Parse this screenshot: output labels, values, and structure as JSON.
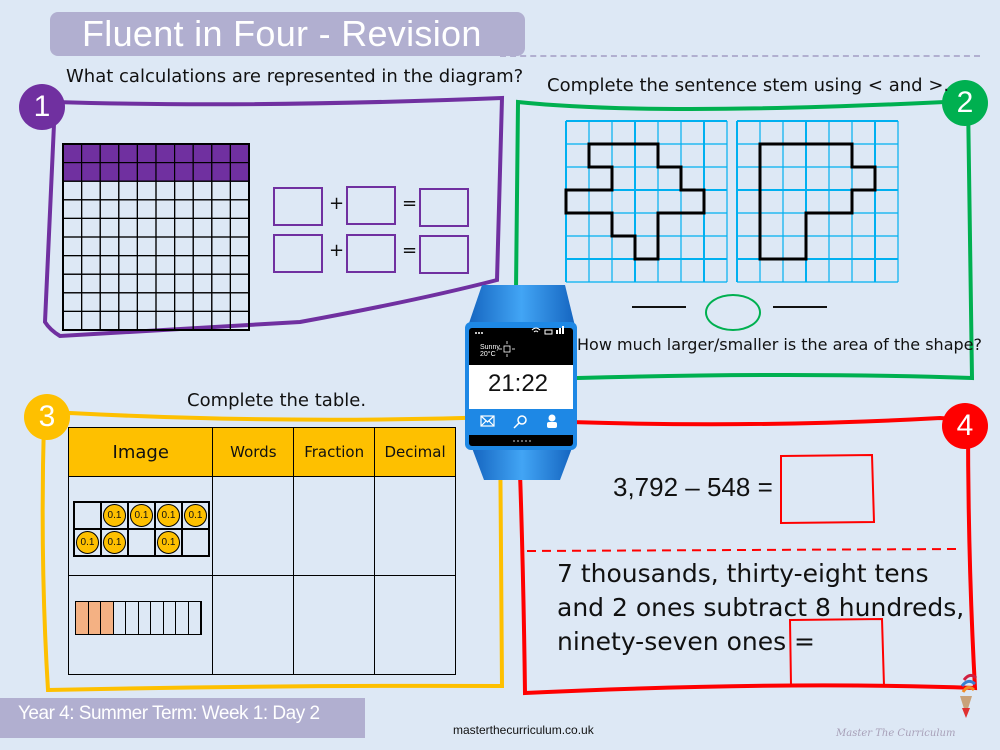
{
  "header": {
    "title": "Fluent in Four - Revision"
  },
  "question1": {
    "number": "1",
    "prompt": "What calculations are represented in the diagram?",
    "hundred_square": {
      "rows": 10,
      "cols": 10,
      "shaded_rows": 2,
      "shaded_count": 20,
      "shade_color": "#7030a0"
    },
    "equations": [
      {
        "plus": "+",
        "equals": "="
      },
      {
        "plus": "+",
        "equals": "="
      }
    ],
    "color": "#7030a0"
  },
  "question2": {
    "number": "2",
    "prompt": "Complete the sentence stem using < and >.",
    "sub_prompt": "How much larger/smaller is the area of the shape?",
    "grid": {
      "rows": 7,
      "cols": 7,
      "line_color": "#00b0f0"
    },
    "shape_a_area": 15,
    "shape_b_area": 15,
    "color": "#00b050"
  },
  "question3": {
    "number": "3",
    "prompt": "Complete the table.",
    "columns": [
      "Image",
      "Words",
      "Fraction",
      "Decimal"
    ],
    "row1_counters": {
      "label": "0.1",
      "layout": [
        [
          0,
          1,
          1,
          1,
          1
        ],
        [
          1,
          1,
          0,
          1,
          0
        ]
      ],
      "count": 7
    },
    "row2_strips": {
      "total": 10,
      "shaded": 3,
      "shade_color": "#f4b183"
    },
    "color": "#fec000"
  },
  "question4": {
    "number": "4",
    "equation": "3,792 – 548 =",
    "word_problem": [
      "7 thousands, thirty-eight tens",
      "and 2 ones subtract 8 hundreds,",
      "ninety-seven ones ="
    ],
    "color": "#ff0000"
  },
  "watch": {
    "time": "21:22",
    "weather": "Sunny",
    "temperature": "20°C",
    "icons": [
      "mail-icon",
      "search-icon",
      "user-icon"
    ]
  },
  "footer": {
    "lesson": "Year 4: Summer Term: Week 1: Day 2",
    "website": "masterthecurriculum.co.uk",
    "brand": "Master The Curriculum"
  }
}
